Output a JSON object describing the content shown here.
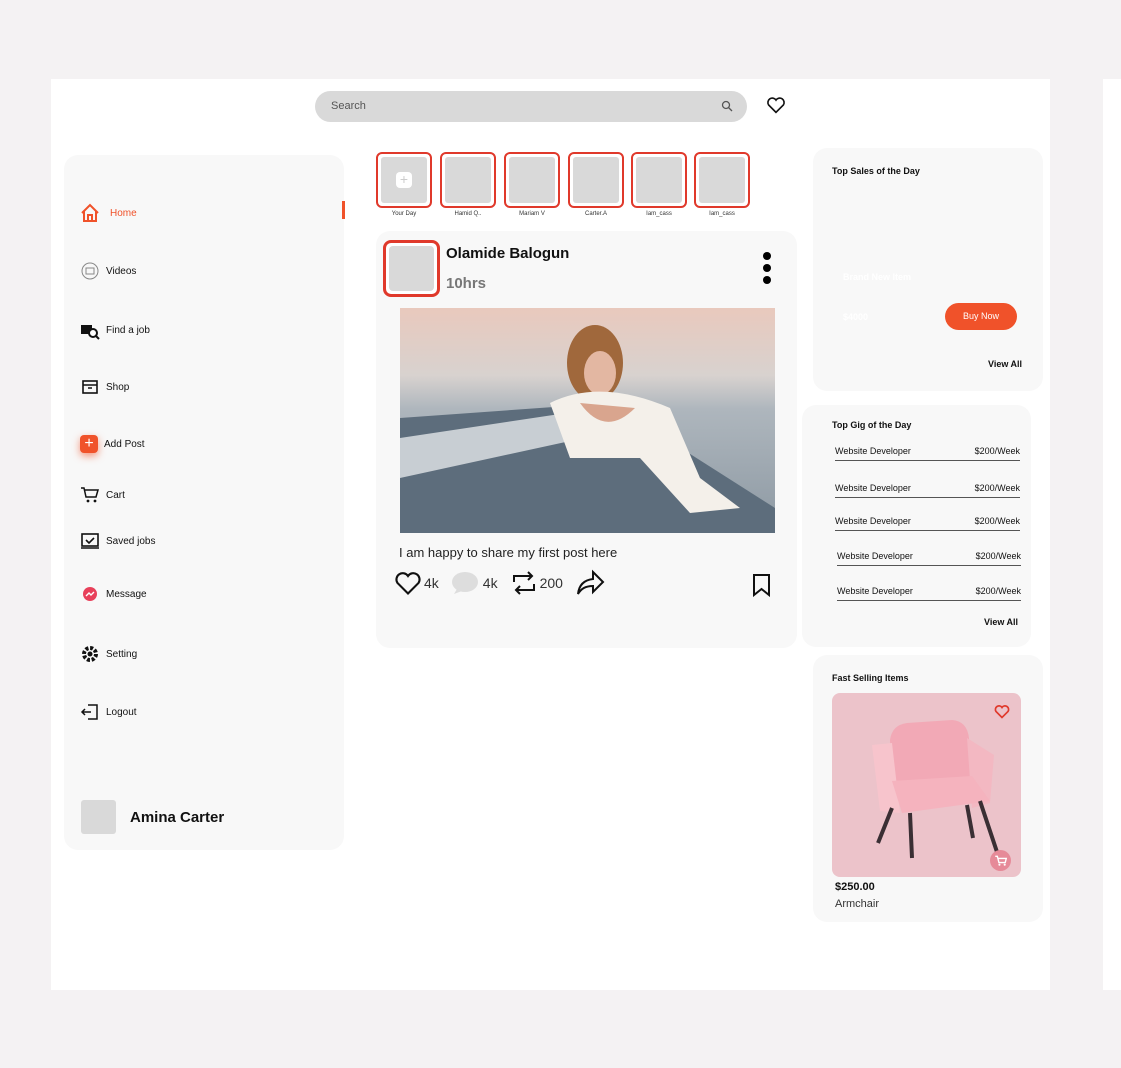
{
  "header": {
    "search_placeholder": "Search",
    "icons": [
      "search-icon",
      "heart-icon"
    ]
  },
  "sidebar": {
    "items": [
      {
        "label": "Home",
        "icon": "home-icon",
        "active": true
      },
      {
        "label": "Videos",
        "icon": "video-icon"
      },
      {
        "label": "Find a job",
        "icon": "job-search-icon"
      },
      {
        "label": "Shop",
        "icon": "shop-icon"
      },
      {
        "label": "Add Post",
        "icon": "plus-icon"
      },
      {
        "label": "Cart",
        "icon": "cart-icon"
      },
      {
        "label": "Saved jobs",
        "icon": "saved-jobs-icon"
      },
      {
        "label": "Message",
        "icon": "messenger-icon"
      },
      {
        "label": "Setting",
        "icon": "gear-icon"
      },
      {
        "label": "Logout",
        "icon": "logout-icon"
      }
    ],
    "user_name": "Amina Carter"
  },
  "stories": [
    "Your Day",
    "Hamid Q..",
    "Mariam V",
    "Carter.A",
    "Iam_cass",
    "Iam_cass"
  ],
  "post": {
    "author": "Olamide Balogun",
    "time": "10hrs",
    "caption": "I am happy to share my first post here",
    "likes": "4k",
    "comments": "4k",
    "reposts": "200"
  },
  "top_sales": {
    "title": "Top Sales of the Day",
    "item_name": "Brand New Item",
    "price": "$4000",
    "buy_label": "Buy Now",
    "view_all": "View All"
  },
  "top_gig": {
    "title": "Top Gig  of the Day",
    "items": [
      {
        "role": "Website Developer",
        "rate": "$200/Week"
      },
      {
        "role": "Website Developer",
        "rate": "$200/Week"
      },
      {
        "role": "Website Developer",
        "rate": "$200/Week"
      },
      {
        "role": "Website Developer",
        "rate": "$200/Week"
      },
      {
        "role": "Website Developer",
        "rate": "$200/Week"
      }
    ],
    "view_all": "View All"
  },
  "fast_selling": {
    "title": "Fast Selling Items",
    "price": "$250.00",
    "name": "Armchair"
  },
  "colors": {
    "accent": "#f0522a",
    "story_border": "#e0392b"
  }
}
